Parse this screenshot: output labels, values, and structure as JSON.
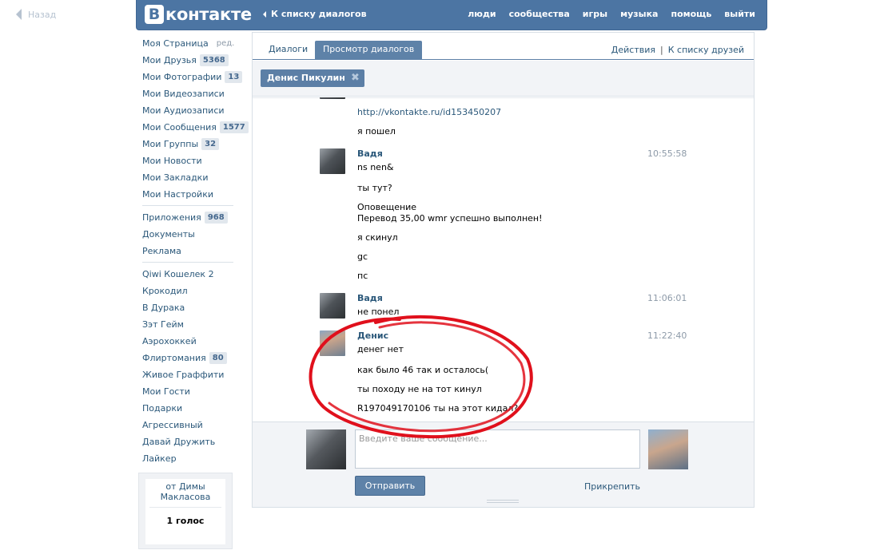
{
  "back_link": "Назад",
  "header": {
    "logo_letter": "B",
    "logo_text": "контакте",
    "back_to_dialogs": "К списку диалогов",
    "nav": [
      "люди",
      "сообщества",
      "игры",
      "музыка",
      "помощь",
      "выйти"
    ]
  },
  "sidebar": {
    "my_page": "Моя Страница",
    "edit": "ред.",
    "items": [
      {
        "label": "Мои Друзья",
        "count": "5368"
      },
      {
        "label": "Мои Фотографии",
        "count": "13"
      },
      {
        "label": "Мои Видеозаписи",
        "count": ""
      },
      {
        "label": "Мои Аудиозаписи",
        "count": ""
      },
      {
        "label": "Мои Сообщения",
        "count": "1577"
      },
      {
        "label": "Мои Группы",
        "count": "32"
      },
      {
        "label": "Мои Новости",
        "count": ""
      },
      {
        "label": "Мои Закладки",
        "count": ""
      },
      {
        "label": "Мои Настройки",
        "count": ""
      }
    ],
    "items2": [
      {
        "label": "Приложения",
        "count": "968"
      },
      {
        "label": "Документы",
        "count": ""
      },
      {
        "label": "Реклама",
        "count": ""
      }
    ],
    "apps": [
      {
        "label": "Qiwi Кошелек 2",
        "count": ""
      },
      {
        "label": "Крокодил",
        "count": ""
      },
      {
        "label": "В Дурака",
        "count": ""
      },
      {
        "label": "Зэт Гейм",
        "count": ""
      },
      {
        "label": "Аэрохоккей",
        "count": ""
      },
      {
        "label": "Флиртомания",
        "count": "80"
      },
      {
        "label": "Живое Граффити",
        "count": ""
      },
      {
        "label": "Мои Гости",
        "count": ""
      },
      {
        "label": "Подарки",
        "count": ""
      },
      {
        "label": "Агрессивный",
        "count": ""
      },
      {
        "label": "Давай Дружить",
        "count": ""
      },
      {
        "label": "Лайкер",
        "count": ""
      }
    ],
    "promo": {
      "from": "от Димы Макласова",
      "votes": "1 голос"
    }
  },
  "tabs": {
    "dialogs": "Диалоги",
    "view": "Просмотр диалогов",
    "actions": "Действия",
    "sep": "|",
    "to_friends": "К списку друзей"
  },
  "filter": {
    "chip": "Денис Пикулин",
    "chip_close": "✖"
  },
  "messages": {
    "pre_link": "http://vkontakte.ru/id153450207",
    "pre_text": "я пошел",
    "m1": {
      "author": "Вадя",
      "time": "10:55:58",
      "lines": [
        "ns nen&",
        "ты тут?",
        "Оповещение",
        "Перевод 35,00 wmr успешно выполнен!",
        "я скинул",
        "gc",
        "пс"
      ]
    },
    "m2": {
      "author": "Вадя",
      "time": "11:06:01",
      "lines": [
        "не понел"
      ]
    },
    "m3": {
      "author": "Денис",
      "time": "11:22:40",
      "lines": [
        "денег нет",
        "как было 46 так и осталось(",
        "ты походу не на тот кинул",
        "R197049170106 ты на этот кидал?"
      ]
    }
  },
  "compose": {
    "placeholder": "Введите ваше сообщение...",
    "send": "Отправить",
    "attach": "Прикрепить"
  },
  "colors": {
    "accent": "#4c75a3",
    "link": "#2b587a",
    "annotation": "#e0101c"
  }
}
